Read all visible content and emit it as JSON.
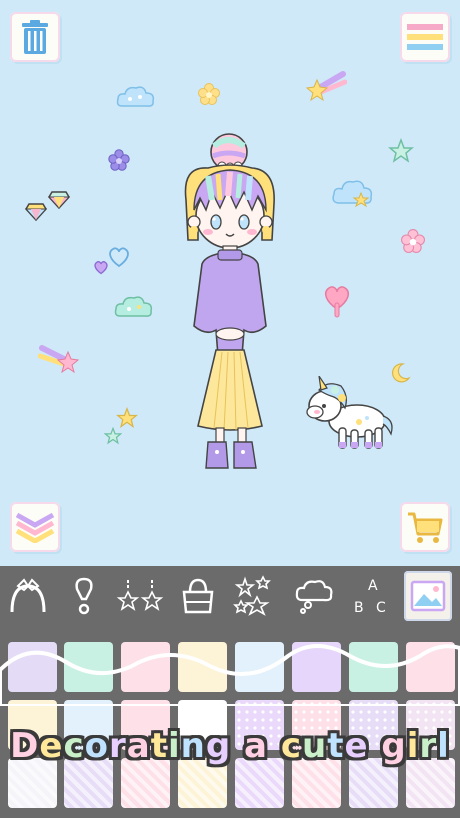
{
  "caption": "Decorating a cute girl",
  "caption_colors": [
    "#ffd1e3",
    "#ffe89a",
    "#c9f0c8",
    "#bfe3ff",
    "#e7d0ff"
  ],
  "top_left_button": {
    "icon": "trash-icon"
  },
  "top_right_button": {
    "icon": "menu-icon"
  },
  "bottom_left_button": {
    "icon": "chevron-down-icon"
  },
  "bottom_right_button": {
    "icon": "cart-icon"
  },
  "toolbar": {
    "tools": [
      "hair-accessory",
      "earring",
      "necklace",
      "bag",
      "sparkle-stickers",
      "speech-bubble",
      "text",
      "background"
    ],
    "text_tool_label": [
      "A",
      "B",
      "C"
    ],
    "active_tool": "background"
  },
  "colors": {
    "background": "#cfe9f9",
    "toolbar": "#6b6b6b",
    "swatches_row1": [
      "#e4dcf7",
      "#c9f1e3",
      "#fde0e8",
      "#fdf3d6",
      "#e2f1fb",
      "#e6d6fb",
      "#c9f1e3",
      "#fde0e8"
    ],
    "swatches_row2": [
      "#fdf3d6",
      "#e2f1fb",
      "#fde0e8",
      "#ffffff",
      "#ead9fb",
      "#fde0e8",
      "#e7ddf7",
      "#f3e4f4"
    ],
    "swatches_row3": [
      "#f4f4f9",
      "#e7ddf7",
      "#fde0e8",
      "#fdf3d6",
      "#ead9fb",
      "#fde0e8",
      "#e7ddf7",
      "#f3e4f4"
    ]
  }
}
